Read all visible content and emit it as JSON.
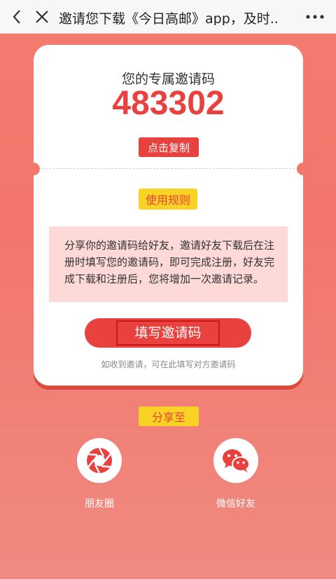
{
  "topbar": {
    "title": "邀请您下载《今日高邮》app，及时..",
    "back_icon": "chevron-left-icon",
    "close_icon": "close-icon",
    "more_icon": "more-dots-icon"
  },
  "card": {
    "code_label": "您的专属邀请码",
    "code_value": "483302",
    "copy_label": "点击复制",
    "rules_label": "使用规则",
    "rules_text": "分享你的邀请码给好友，邀请好友下载后在注册时填写您的邀请码，即可完成注册，好友完成下载和注册后，您将增加一次邀请记录。",
    "fill_label": "填写邀请码",
    "hint": "如收到邀请，可在此填写对方邀请码"
  },
  "share": {
    "title": "分享至",
    "items": [
      {
        "label": "朋友圈",
        "icon": "moments-aperture-icon"
      },
      {
        "label": "微信好友",
        "icon": "wechat-icon"
      }
    ]
  },
  "colors": {
    "accent": "#e8413e",
    "tag": "#f9d324",
    "background": "#f47a6f",
    "rules_bg": "#fdd9d8"
  }
}
